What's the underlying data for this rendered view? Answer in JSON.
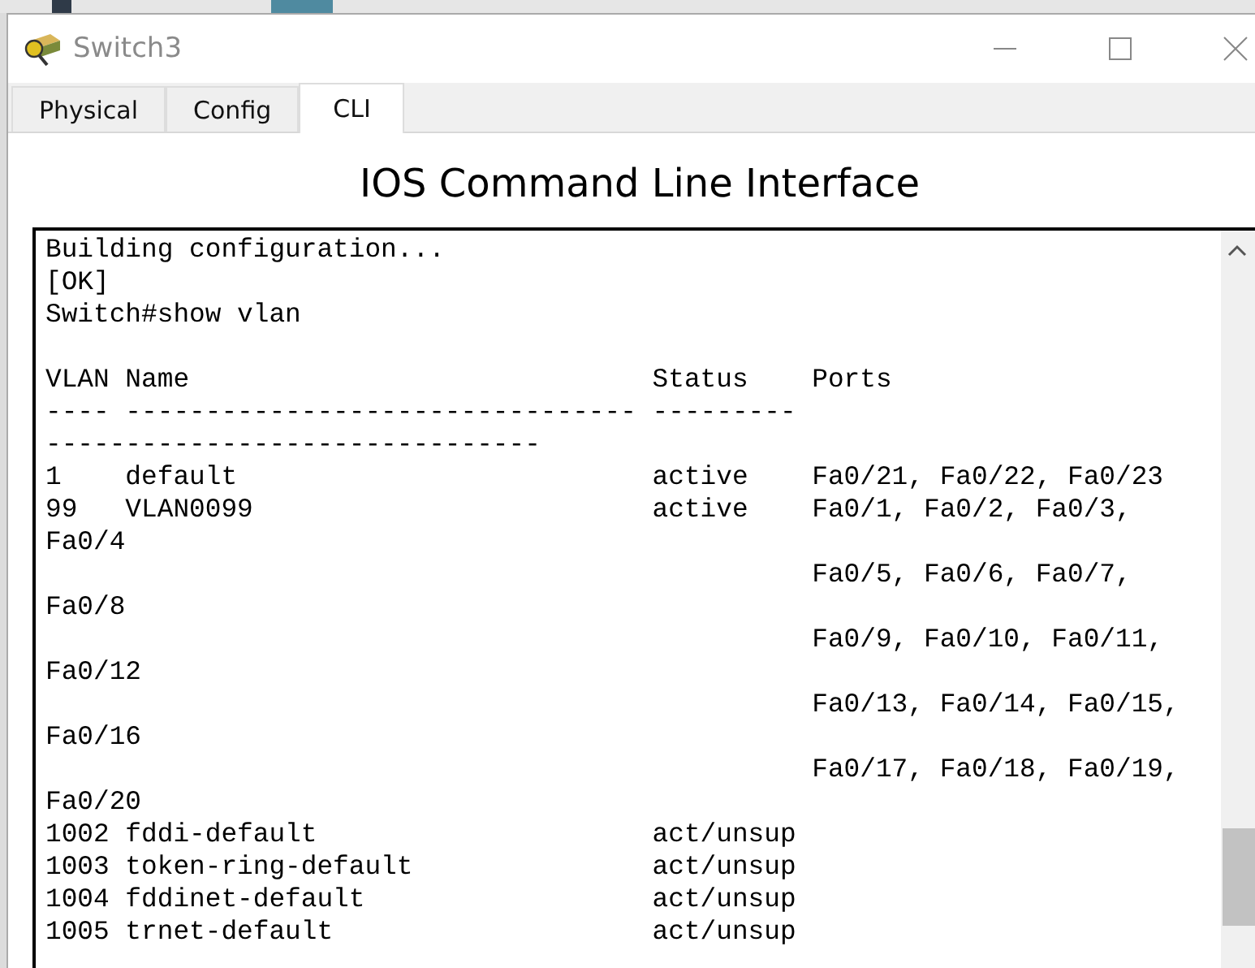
{
  "window": {
    "title": "Switch3"
  },
  "tabs": [
    {
      "label": "Physical",
      "selected": false
    },
    {
      "label": "Config",
      "selected": false
    },
    {
      "label": "CLI",
      "selected": true
    }
  ],
  "heading": "IOS Command Line Interface",
  "console": {
    "blocks": [
      [
        "Building configuration...",
        "[OK]",
        "Switch#show vlan"
      ],
      [
        "VLAN Name                             Status    Ports",
        "---- -------------------------------- ---------",
        "-------------------------------",
        "1    default                          active    Fa0/21, Fa0/22, Fa0/23",
        "99   VLAN0099                         active    Fa0/1, Fa0/2, Fa0/3,",
        "Fa0/4",
        "                                                Fa0/5, Fa0/6, Fa0/7,",
        "Fa0/8",
        "                                                Fa0/9, Fa0/10, Fa0/11,",
        "Fa0/12",
        "                                                Fa0/13, Fa0/14, Fa0/15,",
        "Fa0/16",
        "                                                Fa0/17, Fa0/18, Fa0/19,",
        "Fa0/20",
        "1002 fddi-default                     act/unsup",
        "1003 token-ring-default               act/unsup",
        "1004 fddinet-default                  act/unsup",
        "1005 trnet-default                    act/unsup"
      ]
    ]
  }
}
